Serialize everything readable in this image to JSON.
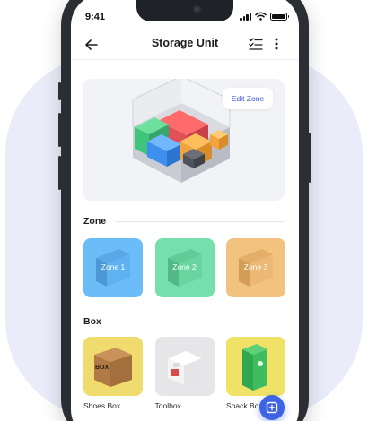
{
  "status_bar": {
    "time": "9:41"
  },
  "header": {
    "title": "Storage Unit"
  },
  "hero": {
    "edit_button_label": "Edit Zone"
  },
  "sections": {
    "zone_title": "Zone",
    "box_title": "Box"
  },
  "zones": [
    {
      "label": "Zone 1",
      "color": "#6cbcf7"
    },
    {
      "label": "Zone 2",
      "color": "#76dfae"
    },
    {
      "label": "Zone 3",
      "color": "#f2c27f"
    }
  ],
  "boxes": [
    {
      "name": "Shoes Box",
      "box_text": "BOX",
      "bg": "#f0dc6e"
    },
    {
      "name": "Toolbox",
      "bg": "#e6e6e8"
    },
    {
      "name": "Snack Box",
      "bg": "#f0e266"
    }
  ],
  "colors": {
    "accent": "#3f63e6",
    "edit_text": "#3b5bd9",
    "backdrop": "#eaecf9"
  },
  "icons": [
    "back-arrow-icon",
    "checklist-icon",
    "more-vertical-icon",
    "wifi-icon",
    "battery-icon",
    "add-box-icon"
  ]
}
